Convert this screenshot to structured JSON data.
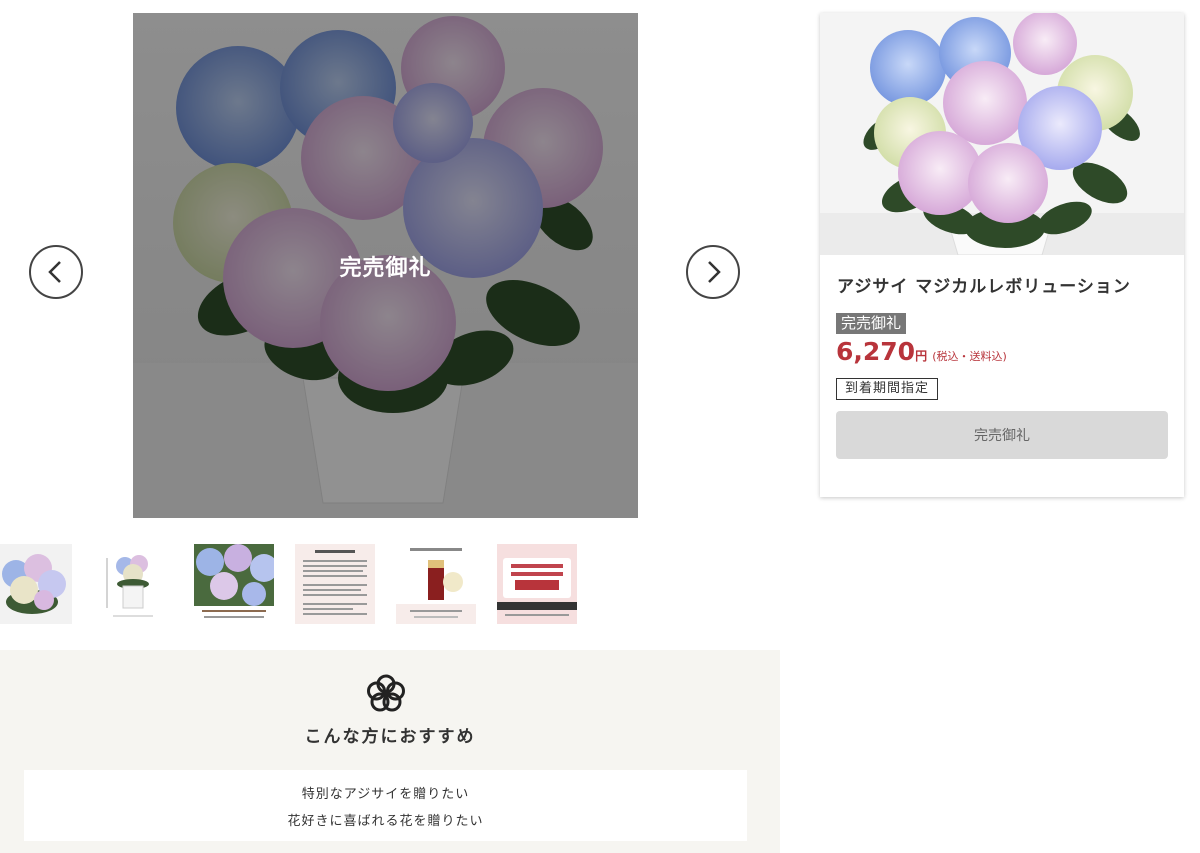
{
  "gallery": {
    "overlay_text": "完売御礼",
    "prev_label": "前へ",
    "next_label": "次へ",
    "thumbnails": [
      {
        "type": "flower"
      },
      {
        "type": "size"
      },
      {
        "type": "closeup",
        "caption": "春の花壇的な色合い\n淡いブルー・ピンク・グリーンのアジサイ"
      },
      {
        "type": "care",
        "heading": "商品のお手入れ方法"
      },
      {
        "type": "box",
        "heading": "専用ボックスでお届け"
      },
      {
        "type": "campaign",
        "line1": "2個以上購入で",
        "line2": "Ontaで使える",
        "points": "500",
        "points_unit": "ポイント",
        "gift": "プレゼント"
      }
    ]
  },
  "product": {
    "name": "アジサイ マジカルレボリューション",
    "soldout_label": "完売御礼",
    "price": "6,270",
    "price_unit": "円",
    "price_note": "(税込・送料込)",
    "delivery_tag": "到着期間指定",
    "button_label": "完売御礼"
  },
  "recommend": {
    "title": "こんな方におすすめ",
    "items": [
      "特別なアジサイを贈りたい",
      "花好きに喜ばれる花を贈りたい"
    ]
  },
  "colors": {
    "price": "#b8343b",
    "overlay": "rgba(0,0,0,0.42)",
    "section_bg": "#f6f5f1",
    "button_bg": "#d9d9d9"
  }
}
